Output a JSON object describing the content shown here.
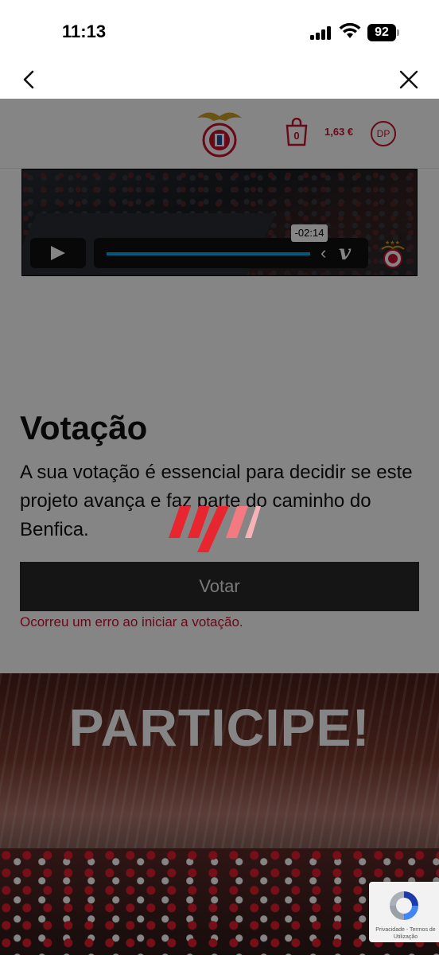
{
  "status_bar": {
    "time": "11:13",
    "battery": "92"
  },
  "nav": {
    "back_icon": "chevron-left-icon",
    "close_icon": "close-icon"
  },
  "site_header": {
    "cart_count": "0",
    "cart_total": "1,63 €",
    "avatar_initials": "DP"
  },
  "video": {
    "time_remaining": "-02:14",
    "play_icon": "play-icon",
    "brand": "v"
  },
  "vote": {
    "title": "Votação",
    "description": "A sua votação é essencial para decidir se este projeto avança e faz parte do caminho do Benfica.",
    "button_label": "Votar",
    "error": "Ocorreu um erro ao iniciar a votação."
  },
  "banner": {
    "title": "PARTICIPE!"
  },
  "recaptcha": {
    "privacy": "Privacidade",
    "separator": "-",
    "terms": "Termos de Utilização"
  },
  "colors": {
    "accent": "#c8102e",
    "video_progress": "#00adef",
    "overlay": "rgba(0,0,0,0.48)"
  }
}
